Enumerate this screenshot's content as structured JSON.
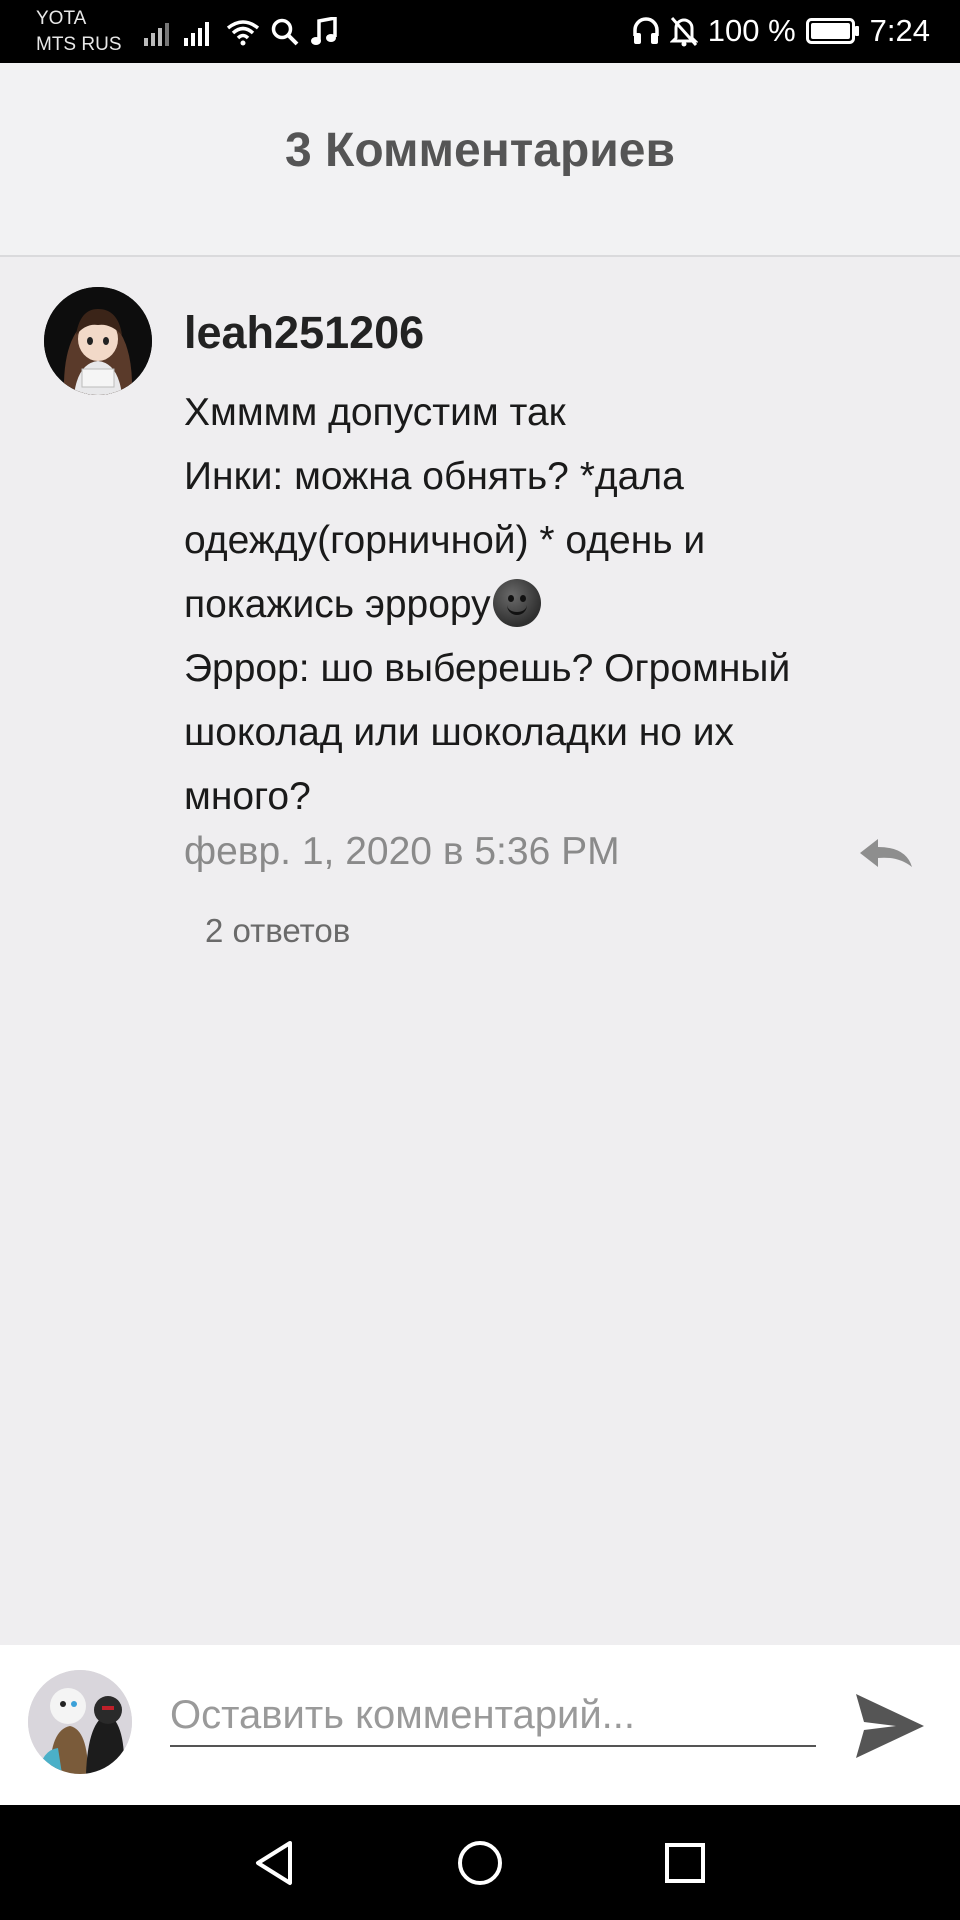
{
  "status_bar": {
    "carrier_1": "YOTA",
    "carrier_2": "MTS RUS",
    "battery": "100 %",
    "time": "7:24",
    "icons": [
      "signal-icon",
      "signal-icon",
      "wifi-icon",
      "search-icon",
      "music-icon",
      "headphones-icon",
      "mute-bell-icon",
      "battery-icon"
    ]
  },
  "header": {
    "title": "3 Комментариев"
  },
  "comment": {
    "username": "leah251206",
    "lines": [
      "Хмммм допустим так",
      "Инки: можна обнять? *дала",
      "одежду(горничной) * одень и",
      "покажись эррору",
      "Эррор: шо выберешь? Огромный",
      "шоколад или шоколадки но их",
      "много?"
    ],
    "emoji": "new-moon-face",
    "timestamp": "февр. 1, 2020 в 5:36 PM",
    "replies": "2 ответов"
  },
  "composer": {
    "placeholder": "Оставить комментарий..."
  },
  "colors": {
    "background": "#efeef0",
    "header_bg": "#f2f2f3",
    "title": "#555555",
    "muted": "#8a8a8a"
  }
}
